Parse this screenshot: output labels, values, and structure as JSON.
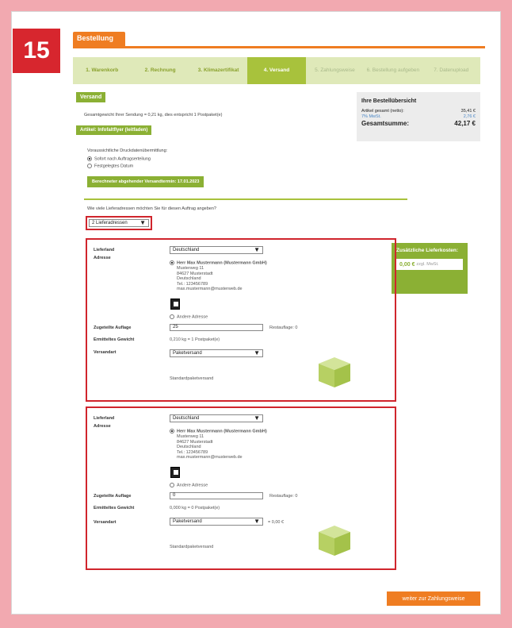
{
  "badge": "15",
  "header": {
    "tab": "Bestellung"
  },
  "steps": [
    "1. Warenkorb",
    "2. Rechnung",
    "3. Klimazertifikat",
    "4. Versand",
    "5. Zahlungsweise",
    "6. Bestellung aufgeben",
    "7. Datenupload"
  ],
  "versand": {
    "tab": "Versand",
    "weight_text": "Gesamtgewicht Ihrer Sendung = 0,21 kg, dies entspricht 1 Postpaket(e)",
    "article_tab": "Artikel: Infofaltflyer (leitfaden)",
    "transfer_label": "Voraussichtliche Druckdatenübermittlung:",
    "option1": "Sofort nach Auftragserteilung",
    "option2": "Festgelegtes Datum",
    "ship_date": "Berechneter abgehender Versandtermin: 17.01.2023",
    "question": "Wie viele Lieferadressen möchten Sie für diesen Auftrag angeben?",
    "count_select": "2 Lieferadressen"
  },
  "summary": {
    "title": "Ihre Bestellübersicht",
    "row1_label": "Artikel gesamt (netto):",
    "row1_value": "35,41 €",
    "row2_label": "7% MwSt.",
    "row2_value": "2,76 €",
    "total_label": "Gesamtsumme:",
    "total_value": "42,17 €"
  },
  "extra": {
    "title": "Zusätzliche Lieferkosten:",
    "value": "0,00 €",
    "suffix": "zzgl. MwSt."
  },
  "addresses": [
    {
      "country_label": "Lieferland",
      "country": "Deutschland",
      "address_label": "Adresse",
      "name": "Herr Max Mustermann (Mustermann GmbH)",
      "lines": [
        "Musterweg 11",
        "84627 Musterstadt",
        "Deutschland",
        "Tel.: 123456789",
        "max.mustermann@musterweb.de"
      ],
      "other": "Andere Adresse",
      "qty_label": "Zugeteilte Auflage",
      "qty": "25",
      "rest": "Restauflage: 0",
      "weight_label": "Ermitteltes Gewicht",
      "weight": "0,210 kg = 1 Postpaket(e)",
      "method_label": "Versandart",
      "method": "Paketversand",
      "price": "",
      "std": "Standardpaketversand"
    },
    {
      "country_label": "Lieferland",
      "country": "Deutschland",
      "address_label": "Adresse",
      "name": "Herr Max Mustermann (Mustermann GmbH)",
      "lines": [
        "Musterweg 11",
        "84627 Musterstadt",
        "Deutschland",
        "Tel.: 123456789",
        "max.mustermann@musterweb.de"
      ],
      "other": "Andere Adresse",
      "qty_label": "Zugeteilte Auflage",
      "qty": "0",
      "rest": "Restauflage: 0",
      "weight_label": "Ermitteltes Gewicht",
      "weight": "0,000 kg = 0 Postpaket(e)",
      "method_label": "Versandart",
      "method": "Paketversand",
      "price": "= 0,00 €",
      "std": "Standardpaketversand"
    }
  ],
  "next_button": "weiter zur Zahlungsweise"
}
